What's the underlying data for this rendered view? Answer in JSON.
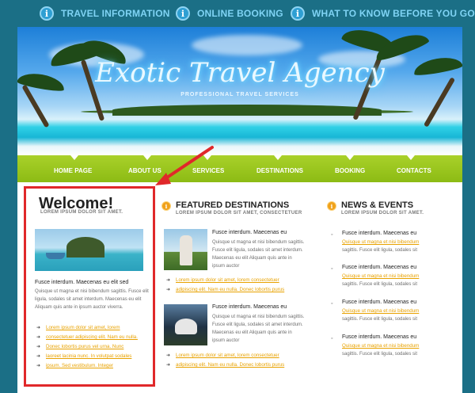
{
  "topnav": [
    {
      "label": "TRAVEL INFORMATION",
      "icon": "info-icon"
    },
    {
      "label": "ONLINE BOOKING",
      "icon": "info-icon"
    },
    {
      "label": "WHAT TO KNOW BEFORE YOU GO",
      "icon": "info-icon"
    }
  ],
  "banner": {
    "title": "Exotic Travel Agency",
    "subtitle": "PROFESSIONAL TRAVEL SERVICES"
  },
  "menu": [
    "HOME PAGE",
    "ABOUT US",
    "SERVICES",
    "DESTINATIONS",
    "BOOKING",
    "CONTACTS"
  ],
  "welcome": {
    "title": "Welcome!",
    "subtitle": "LOREM IPSUM DOLOR SIT AMET.",
    "lead": "Fusce interdum. Maecenas eu elit sed",
    "body": "Quisque ut magna et nisi bibendum sagittis. Fusce elit ligula, sodales sit amet interdum. Maecenas eu elit Aliquam quis ante in ipsum auctor viverra.",
    "links": [
      "Lorem ipsum dolor sit amet, lorem",
      "consectetuer adipiscing elit. Nam eu nulla.",
      "Donec lobortis purus vel urna. Nunc",
      "laoreet lacinia nunc. In volutpat sodales",
      "ipsum. Sed vestibulum. Integer"
    ]
  },
  "featured": {
    "title": "FEATURED DESTINATIONS",
    "subtitle": "LOREM IPSUM DOLOR SIT AMET, CONSECTETUER",
    "items": [
      {
        "lead": "Fusce interdum. Maecenas eu",
        "body": "Quisque ut magna et nisi bibendum sagittis. Fusce elit ligula, sodales sit amet interdum. Maecenas eu elit Aliquam quis ante in ipsum auctor",
        "links": [
          "Lorem ipsum dolor sit amet, lorem consectetuer",
          "adipiscing elit. Nam eu nulla. Donec lobortis purus"
        ]
      },
      {
        "lead": "Fusce interdum. Maecenas eu",
        "body": "Quisque ut magna et nisi bibendum sagittis. Fusce elit ligula, sodales sit amet interdum. Maecenas eu elit Aliquam quis ante in ipsum auctor",
        "links": [
          "Lorem ipsum dolor sit amet, lorem consectetuer",
          "adipiscing elit. Nam eu nulla. Donec lobortis purus"
        ]
      }
    ]
  },
  "news": {
    "title": "NEWS & EVENTS",
    "subtitle": "LOREM IPSUM DOLOR SIT AMET.",
    "items": [
      {
        "lead": "Fusce interdum. Maecenas eu",
        "link": "Quisque ut magna et nisi bibendum",
        "tail": "sagittis. Fusce elit ligula, sodales sit"
      },
      {
        "lead": "Fusce interdum. Maecenas eu",
        "link": "Quisque ut magna et nisi bibendum",
        "tail": "sagittis. Fusce elit ligula, sodales sit"
      },
      {
        "lead": "Fusce interdum. Maecenas eu",
        "link": "Quisque ut magna et nisi bibendum",
        "tail": "sagittis. Fusce elit ligula, sodales sit"
      },
      {
        "lead": "Fusce interdum. Maecenas eu",
        "link": "Quisque ut magna et nisi bibendum",
        "tail": "sagittis. Fusce elit ligula, sodales sit"
      }
    ]
  },
  "colors": {
    "background": "#1b6f86",
    "menu_green": "#9ac51f",
    "link_orange": "#e8a200",
    "annotation_red": "#e0282a"
  }
}
